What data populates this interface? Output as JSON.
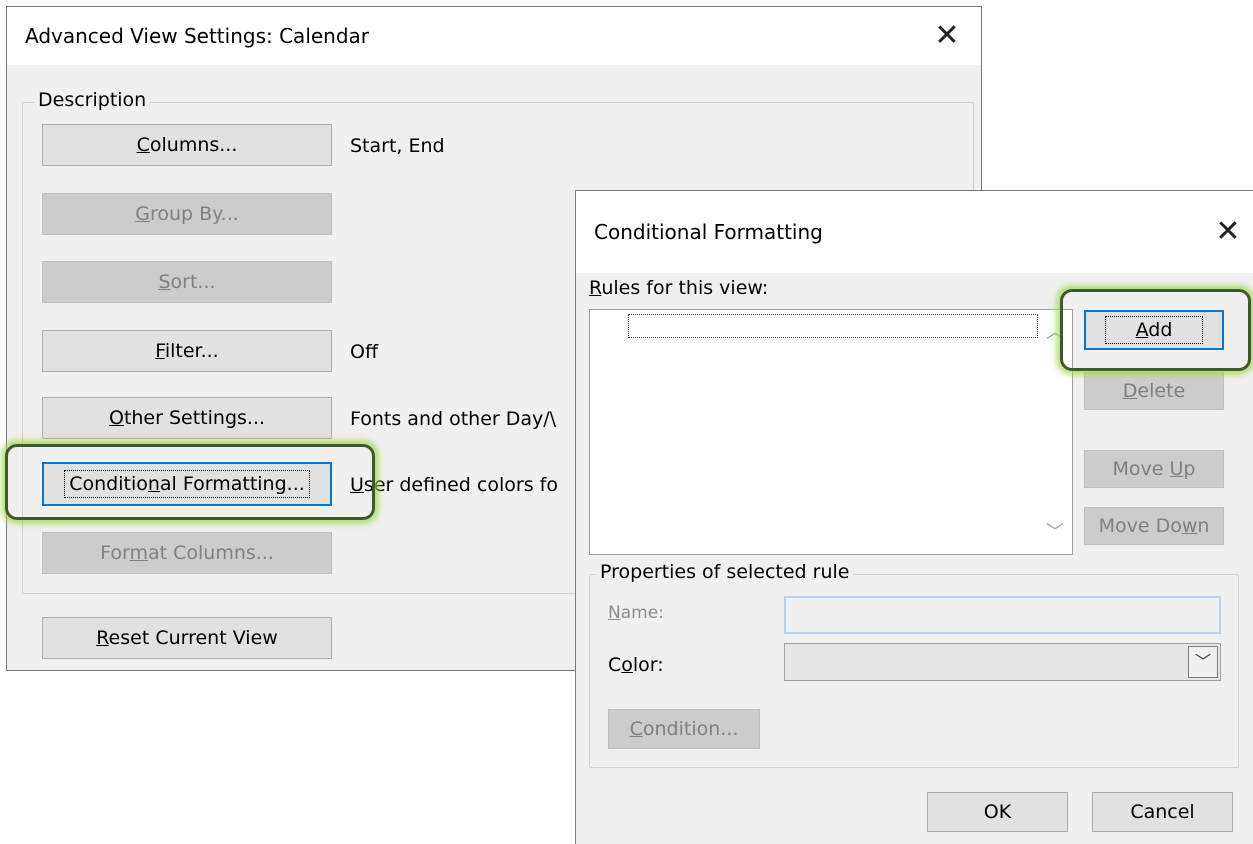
{
  "dialog1": {
    "title": "Advanced View Settings: Calendar",
    "group_label": "Description",
    "buttons": [
      {
        "pre": "",
        "key": "C",
        "post": "olumns...",
        "desc": "Start, End",
        "enabled": true
      },
      {
        "pre": "",
        "key": "G",
        "post": "roup By...",
        "desc": "",
        "enabled": false
      },
      {
        "pre": "",
        "key": "S",
        "post": "ort...",
        "desc": "",
        "enabled": false
      },
      {
        "pre": "",
        "key": "F",
        "post": "ilter...",
        "desc": "Off",
        "enabled": true
      },
      {
        "pre": "",
        "key": "O",
        "post": "ther Settings...",
        "desc": "Fonts and other Day/\\",
        "enabled": true
      },
      {
        "pre": "Conditio",
        "key": "n",
        "post": "al Formatting...",
        "desc_key": "U",
        "desc": "ser defined colors fo",
        "enabled": true
      },
      {
        "pre": "For",
        "key": "m",
        "post": "at Columns...",
        "desc": "",
        "enabled": false
      }
    ],
    "reset": {
      "pre": "",
      "key": "R",
      "post": "eset Current View"
    }
  },
  "dialog2": {
    "title": "Conditional Formatting",
    "rules_label": {
      "key": "R",
      "post": "ules for this view:"
    },
    "add": {
      "key": "A",
      "post": "dd"
    },
    "delete": {
      "key": "D",
      "post": "elete"
    },
    "move_up": {
      "pre": "Move ",
      "key": "U",
      "post": "p"
    },
    "move_down": {
      "pre": "Move Do",
      "key": "w",
      "post": "n"
    },
    "properties_label": "Properties of selected rule",
    "name_label": {
      "key": "N",
      "post": "ame:"
    },
    "color_label": {
      "pre": "C",
      "key": "o",
      "post": "lor:"
    },
    "condition": {
      "key": "C",
      "post": "ondition..."
    },
    "ok": "OK",
    "cancel": "Cancel"
  },
  "icons": {
    "close": "close-icon",
    "combo_arrow": "chevron-down-icon",
    "scroll_up": "chevron-up-icon",
    "scroll_down": "chevron-down-icon"
  }
}
